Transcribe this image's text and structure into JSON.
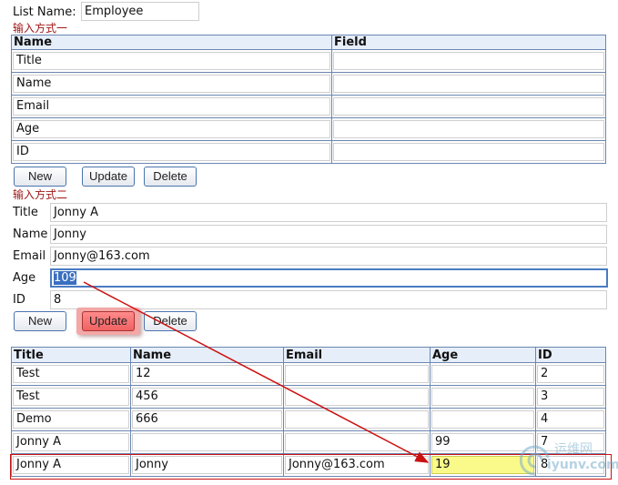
{
  "list_name": {
    "label": "List Name:",
    "value": "Employee"
  },
  "section1": {
    "caption": "输入方式一",
    "columns": [
      "Name",
      "Field"
    ],
    "rows": [
      {
        "name": "Title",
        "field": ""
      },
      {
        "name": "Name",
        "field": ""
      },
      {
        "name": "Email",
        "field": ""
      },
      {
        "name": "Age",
        "field": ""
      },
      {
        "name": "ID",
        "field": ""
      }
    ],
    "buttons": {
      "new": "New",
      "update": "Update",
      "delete": "Delete"
    }
  },
  "section2": {
    "caption": "输入方式二",
    "fields": [
      {
        "label": "Title",
        "value": "Jonny A"
      },
      {
        "label": "Name",
        "value": "Jonny"
      },
      {
        "label": "Email",
        "value": "Jonny@163.com"
      },
      {
        "label": "Age",
        "value": "109"
      },
      {
        "label": "ID",
        "value": "8"
      }
    ],
    "buttons": {
      "new": "New",
      "update": "Update",
      "delete": "Delete"
    }
  },
  "results": {
    "columns": [
      "Title",
      "Name",
      "Email",
      "Age",
      "ID"
    ],
    "rows": [
      [
        "Test",
        "12",
        "",
        "",
        "2"
      ],
      [
        "Test",
        "456",
        "",
        "",
        "3"
      ],
      [
        "Demo",
        "666",
        "",
        "",
        "4"
      ],
      [
        "Jonny A",
        "",
        "",
        "99",
        "7"
      ],
      [
        "Jonny A",
        "Jonny",
        "Jonny@163.com",
        "19",
        "8"
      ]
    ]
  },
  "watermark": {
    "line1": "运维网",
    "line2": "iyunv.com"
  },
  "colors": {
    "accent_red": "#cc1111",
    "highlight_yellow": "#fafa8a",
    "grid_border": "#6b86b0",
    "selection_blue": "#3a6fc0"
  }
}
